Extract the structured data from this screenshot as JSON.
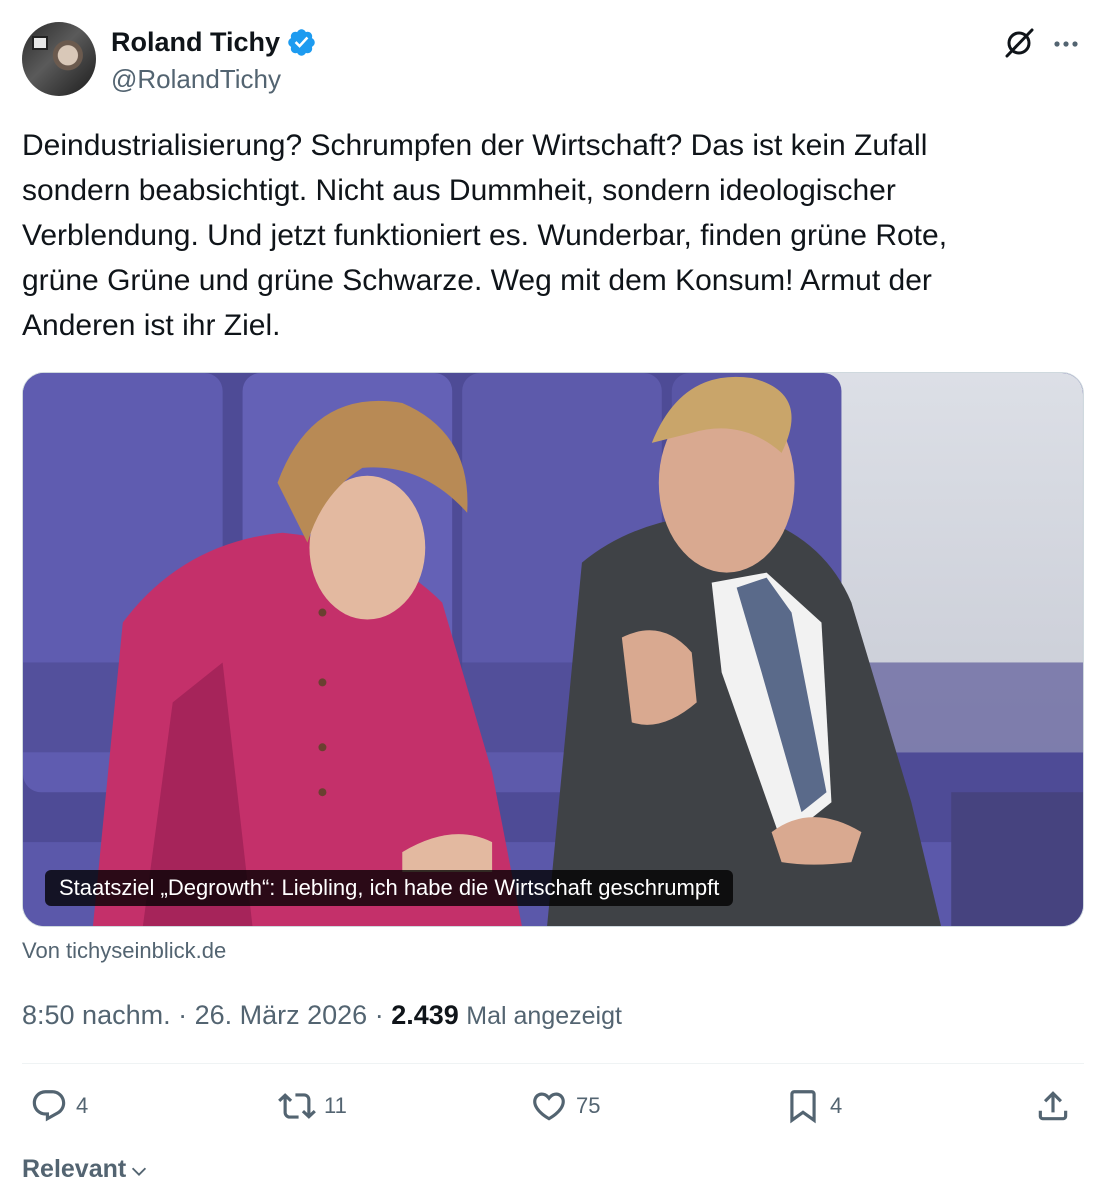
{
  "author": {
    "name": "Roland Tichy",
    "handle": "@RolandTichy",
    "verified": true
  },
  "tweet": {
    "text": "Deindustrialisierung? Schrumpfen der Wirtschaft? Das ist kein Zufall\nsondern beabsichtigt. Nicht aus Dummheit, sondern ideologischer\nVerblendung. Und jetzt funktioniert es. Wunderbar, finden grüne Rote,\ngrüne Grüne und grüne Schwarze. Weg mit dem Konsum! Armut der\nAnderen ist ihr Ziel."
  },
  "card": {
    "caption": "Staatsziel „Degrowth“: Liebling, ich habe die Wirtschaft geschrumpft",
    "source": "Von tichyseinblick.de"
  },
  "meta": {
    "time": "8:50 nachm.",
    "separator": " · ",
    "date": "26. März 2026",
    "views_count": "2.439",
    "views_label": "Mal angezeigt"
  },
  "actions": {
    "replies": "4",
    "retweets": "11",
    "likes": "75",
    "bookmarks": "4"
  },
  "sort": {
    "label": "Relevant"
  },
  "icons": {
    "verified": "verified-badge-icon",
    "grok": "grok-icon",
    "more": "more-icon",
    "reply": "reply-icon",
    "retweet": "retweet-icon",
    "like": "heart-icon",
    "bookmark": "bookmark-icon",
    "share": "share-icon",
    "sort": "chevron-down-icon"
  },
  "colors": {
    "text": "#0f1419",
    "secondary": "#536471",
    "verified": "#1d9bf0",
    "divider": "#eff3f4"
  }
}
